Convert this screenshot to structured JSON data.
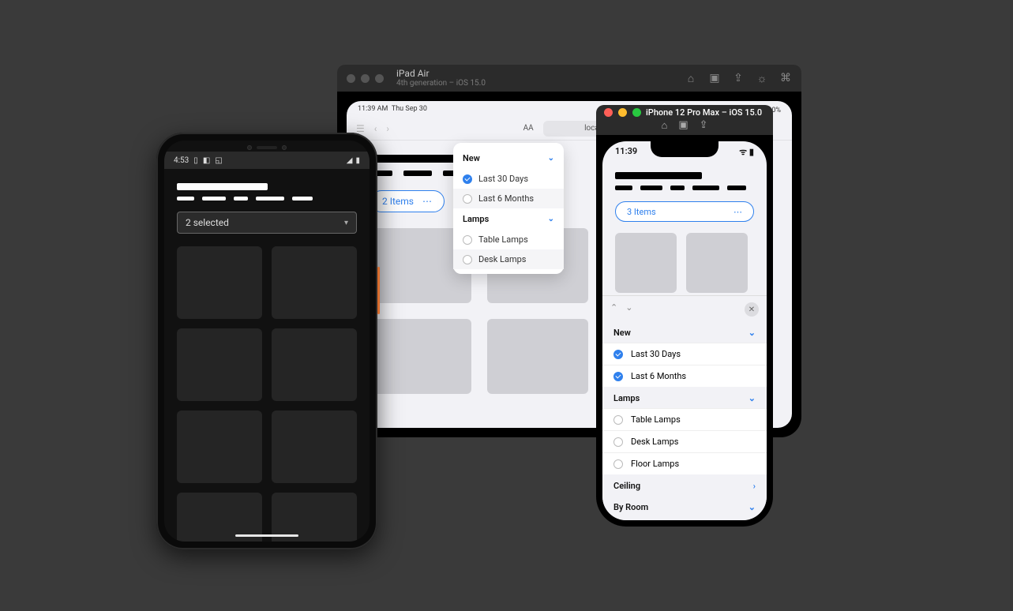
{
  "ipad": {
    "title": "iPad Air",
    "subtitle": "4th generation – iOS 15.0",
    "status_time": "11:39 AM",
    "status_date": "Thu Sep 30",
    "url": "localhost",
    "text_size": "AA",
    "pill_label": "2 Items",
    "popover": {
      "section1": "New",
      "opt1": "Last 30 Days",
      "opt2": "Last 6 Months",
      "section2": "Lamps",
      "opt3": "Table Lamps",
      "opt4": "Desk Lamps"
    }
  },
  "iphone": {
    "title": "iPhone 12 Pro Max – iOS 15.0",
    "status_time": "11:39",
    "pill_label": "3 Items",
    "sheet": {
      "section1": "New",
      "s1opt1": "Last 30 Days",
      "s1opt2": "Last 6 Months",
      "section2": "Lamps",
      "s2opt1": "Table Lamps",
      "s2opt2": "Desk Lamps",
      "s2opt3": "Floor Lamps",
      "section3": "Ceiling",
      "section4": "By Room"
    }
  },
  "android": {
    "status_time": "4:53",
    "select_label": "2 selected"
  }
}
